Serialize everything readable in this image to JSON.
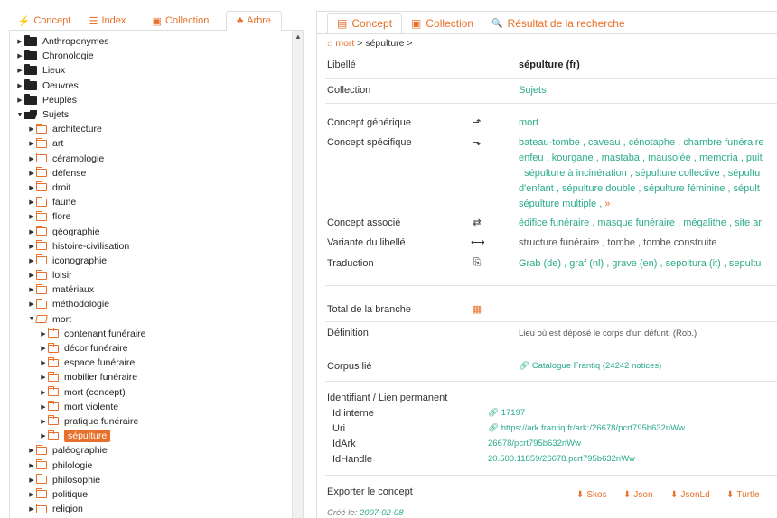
{
  "left_tabs": [
    {
      "label": "Concept",
      "icon": "sitemap-icon",
      "glyph": "⚡"
    },
    {
      "label": "Index",
      "icon": "list-icon",
      "glyph": "☰"
    },
    {
      "label": "Collection",
      "icon": "collection-icon",
      "glyph": "▣"
    },
    {
      "label": "Arbre",
      "icon": "tree-icon",
      "glyph": "♣"
    }
  ],
  "tree": [
    {
      "label": "Anthroponymes",
      "level": 0,
      "state": "closed"
    },
    {
      "label": "Chronologie",
      "level": 0,
      "state": "closed"
    },
    {
      "label": "Lieux",
      "level": 0,
      "state": "closed"
    },
    {
      "label": "Oeuvres",
      "level": 0,
      "state": "closed"
    },
    {
      "label": "Peuples",
      "level": 0,
      "state": "closed"
    },
    {
      "label": "Sujets",
      "level": 0,
      "state": "open"
    },
    {
      "label": "architecture",
      "level": 1,
      "state": "closed"
    },
    {
      "label": "art",
      "level": 1,
      "state": "closed"
    },
    {
      "label": "céramologie",
      "level": 1,
      "state": "closed"
    },
    {
      "label": "défense",
      "level": 1,
      "state": "closed"
    },
    {
      "label": "droit",
      "level": 1,
      "state": "closed"
    },
    {
      "label": "faune",
      "level": 1,
      "state": "closed"
    },
    {
      "label": "flore",
      "level": 1,
      "state": "closed"
    },
    {
      "label": "géographie",
      "level": 1,
      "state": "closed"
    },
    {
      "label": "histoire-civilisation",
      "level": 1,
      "state": "closed"
    },
    {
      "label": "iconographie",
      "level": 1,
      "state": "closed"
    },
    {
      "label": "loisir",
      "level": 1,
      "state": "closed"
    },
    {
      "label": "matériaux",
      "level": 1,
      "state": "closed"
    },
    {
      "label": "méthodologie",
      "level": 1,
      "state": "closed"
    },
    {
      "label": "mort",
      "level": 1,
      "state": "open"
    },
    {
      "label": "contenant funéraire",
      "level": 2,
      "state": "closed"
    },
    {
      "label": "décor funéraire",
      "level": 2,
      "state": "closed"
    },
    {
      "label": "espace funéraire",
      "level": 2,
      "state": "closed"
    },
    {
      "label": "mobilier funéraire",
      "level": 2,
      "state": "closed"
    },
    {
      "label": "mort (concept)",
      "level": 2,
      "state": "closed"
    },
    {
      "label": "mort violente",
      "level": 2,
      "state": "closed"
    },
    {
      "label": "pratique funéraire",
      "level": 2,
      "state": "closed"
    },
    {
      "label": "sépulture",
      "level": 2,
      "state": "closed",
      "selected": true
    },
    {
      "label": "paléographie",
      "level": 1,
      "state": "closed"
    },
    {
      "label": "philologie",
      "level": 1,
      "state": "closed"
    },
    {
      "label": "philosophie",
      "level": 1,
      "state": "closed"
    },
    {
      "label": "politique",
      "level": 1,
      "state": "closed"
    },
    {
      "label": "religion",
      "level": 1,
      "state": "closed"
    }
  ],
  "right_tabs": [
    {
      "label": "Concept",
      "icon": "document-icon",
      "glyph": "▤"
    },
    {
      "label": "Collection",
      "icon": "collection-icon",
      "glyph": "▣"
    },
    {
      "label": "Résultat de la recherche",
      "icon": "search-icon",
      "glyph": "🔍"
    }
  ],
  "breadcrumb": {
    "home_glyph": "⌂",
    "link": "mort",
    "sep1": " > ",
    "current": "sépulture",
    "sep2": " >"
  },
  "fields": {
    "libelle_label": "Libellé",
    "libelle_value": "sépulture (fr)",
    "collection_label": "Collection",
    "collection_value": "Sujets",
    "generique_label": "Concept générique",
    "generique_icon": "arrow-up-icon",
    "generique_value": "mort",
    "specifique_label": "Concept spécifique",
    "specifique_icon": "arrow-down-icon",
    "specifique_lines": [
      "bateau-tombe , caveau , cénotaphe , chambre funéraire",
      "enfeu , kourgane , mastaba , mausolée , memoria , puit",
      ", sépulture à incinération , sépulture collective , sépultu",
      "d'enfant , sépulture double , sépulture féminine , sépult",
      "sépulture multiple , »"
    ],
    "associe_label": "Concept associé",
    "associe_icon": "exchange-icon",
    "associe_value": "édifice funéraire , masque funéraire , mégalithe , site ar",
    "variante_label": "Variante du libellé",
    "variante_icon": "double-arrow-icon",
    "variante_value": "structure funéraire , tombe , tombe construite",
    "traduction_label": "Traduction",
    "traduction_icon": "translate-icon",
    "traduction_value": "Grab (de) , graf (nl) , grave (en) , sepoltura (it) , sepultu",
    "total_label": "Total de la branche",
    "total_icon": "calculator-icon",
    "definition_label": "Définition",
    "definition_value": "Lieu où est déposé le corps d'un défunt. (Rob.)",
    "corpus_label": "Corpus lié",
    "corpus_value": "Catalogue Frantiq (24242 notices)",
    "ident_label": "Identifiant / Lien permanent",
    "id_interne_label": "Id interne",
    "id_interne_value": "17197",
    "uri_label": "Uri",
    "uri_value": "https://ark.frantiq.fr/ark:/26678/pcrt795b632nWw",
    "idark_label": "IdArk",
    "idark_value": "26678/pcrt795b632nWw",
    "idhandle_label": "IdHandle",
    "idhandle_value": "20.500.11859/26678.pcrt795b632nWw",
    "export_label": "Exporter le concept",
    "created_label": "Créé le:",
    "created_value": "2007-02-08"
  },
  "exports": [
    "Skos",
    "Json",
    "JsonLd",
    "Turtle"
  ],
  "colors": {
    "accent": "#e8702a",
    "link": "#2aaa8a",
    "border": "#dddddd"
  }
}
